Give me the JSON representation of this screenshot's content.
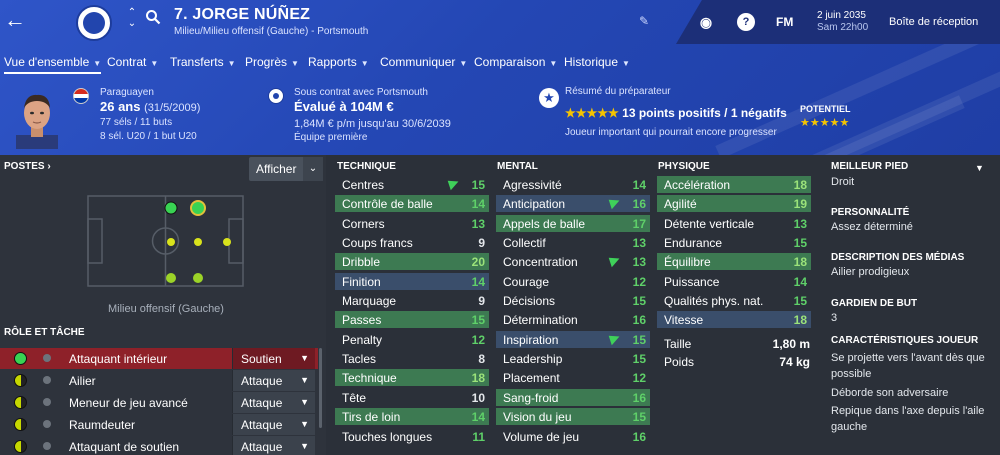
{
  "header": {
    "player_name": "7. JORGE NÚÑEZ",
    "subtitle": "Milieu/Milieu offensif (Gauche) - Portsmouth",
    "date": "2 juin 2035",
    "time": "Sam 22h00",
    "fm_label": "FM",
    "inbox": "Boîte de réception"
  },
  "nav": [
    {
      "label": "Vue d'ensemble"
    },
    {
      "label": "Contrat"
    },
    {
      "label": "Transferts"
    },
    {
      "label": "Progrès"
    },
    {
      "label": "Rapports"
    },
    {
      "label": "Communiquer"
    },
    {
      "label": "Comparaison"
    },
    {
      "label": "Historique"
    }
  ],
  "info": {
    "nationality": "Paraguayen",
    "age": "26 ans",
    "dob": "(31/5/2009)",
    "club_caps": "77 séls / 11 buts",
    "youth_caps": "8 sél. U20 / 1 but U20",
    "contract_label": "Sous contrat avec Portsmouth",
    "value": "Évalué à 104M €",
    "wage": "1,84M € p/m jusqu'au 30/6/2039",
    "squad_status": "Équipe première",
    "report_title": "Résumé du préparateur",
    "report_main": "13 points positifs / 1 négatifs",
    "report_stars": "★★★★★",
    "report_desc": "Joueur important qui pourrait encore progresser",
    "potential_label": "POTENTIEL",
    "potential_stars": "★★★★★"
  },
  "positions": {
    "title": "POSTES",
    "show_button": "Afficher",
    "position_label": "Milieu offensif (Gauche)"
  },
  "roles": {
    "title": "RÔLE ET TÂCHE",
    "items": [
      {
        "name": "Attaquant intérieur",
        "duty": "Soutien"
      },
      {
        "name": "Ailier",
        "duty": "Attaque"
      },
      {
        "name": "Meneur de jeu avancé",
        "duty": "Attaque"
      },
      {
        "name": "Raumdeuter",
        "duty": "Attaque"
      },
      {
        "name": "Attaquant de soutien",
        "duty": "Attaque"
      }
    ]
  },
  "attributes": {
    "technique_title": "TECHNIQUE",
    "mental_title": "MENTAL",
    "physique_title": "PHYSIQUE",
    "technique": [
      {
        "name": "Centres",
        "value": "15"
      },
      {
        "name": "Contrôle de balle",
        "value": "14"
      },
      {
        "name": "Corners",
        "value": "13"
      },
      {
        "name": "Coups francs",
        "value": "9"
      },
      {
        "name": "Dribble",
        "value": "20"
      },
      {
        "name": "Finition",
        "value": "14"
      },
      {
        "name": "Marquage",
        "value": "9"
      },
      {
        "name": "Passes",
        "value": "15"
      },
      {
        "name": "Penalty",
        "value": "12"
      },
      {
        "name": "Tacles",
        "value": "8"
      },
      {
        "name": "Technique",
        "value": "18"
      },
      {
        "name": "Tête",
        "value": "10"
      },
      {
        "name": "Tirs de loin",
        "value": "14"
      },
      {
        "name": "Touches longues",
        "value": "11"
      }
    ],
    "mental": [
      {
        "name": "Agressivité",
        "value": "14"
      },
      {
        "name": "Anticipation",
        "value": "16"
      },
      {
        "name": "Appels de balle",
        "value": "17"
      },
      {
        "name": "Collectif",
        "value": "13"
      },
      {
        "name": "Concentration",
        "value": "13"
      },
      {
        "name": "Courage",
        "value": "12"
      },
      {
        "name": "Décisions",
        "value": "15"
      },
      {
        "name": "Détermination",
        "value": "16"
      },
      {
        "name": "Inspiration",
        "value": "15"
      },
      {
        "name": "Leadership",
        "value": "15"
      },
      {
        "name": "Placement",
        "value": "12"
      },
      {
        "name": "Sang-froid",
        "value": "16"
      },
      {
        "name": "Vision du jeu",
        "value": "15"
      },
      {
        "name": "Volume de jeu",
        "value": "16"
      }
    ],
    "physique": [
      {
        "name": "Accélération",
        "value": "18"
      },
      {
        "name": "Agilité",
        "value": "19"
      },
      {
        "name": "Détente verticale",
        "value": "13"
      },
      {
        "name": "Endurance",
        "value": "15"
      },
      {
        "name": "Équilibre",
        "value": "18"
      },
      {
        "name": "Puissance",
        "value": "14"
      },
      {
        "name": "Qualités phys. nat.",
        "value": "15"
      },
      {
        "name": "Vitesse",
        "value": "18"
      }
    ],
    "height_label": "Taille",
    "height": "1,80 m",
    "weight_label": "Poids",
    "weight": "74 kg"
  },
  "right_panel": {
    "foot_title": "MEILLEUR PIED",
    "foot": "Droit",
    "personality_title": "PERSONNALITÉ",
    "personality": "Assez déterminé",
    "media_title": "DESCRIPTION DES MÉDIAS",
    "media": "Ailier prodigieux",
    "gk_title": "GARDIEN DE BUT",
    "gk": "3",
    "traits_title": "CARACTÉRISTIQUES JOUEUR",
    "traits": [
      "Se projette vers l'avant dès que possible",
      "Déborde son adversaire",
      "Repique dans l'axe depuis l'aile gauche"
    ]
  },
  "colors": {
    "header_blue": "#2447b4",
    "highlight_green": "#3d7a52",
    "selected_red": "#8e2129",
    "star_gold": "#f5c400"
  }
}
